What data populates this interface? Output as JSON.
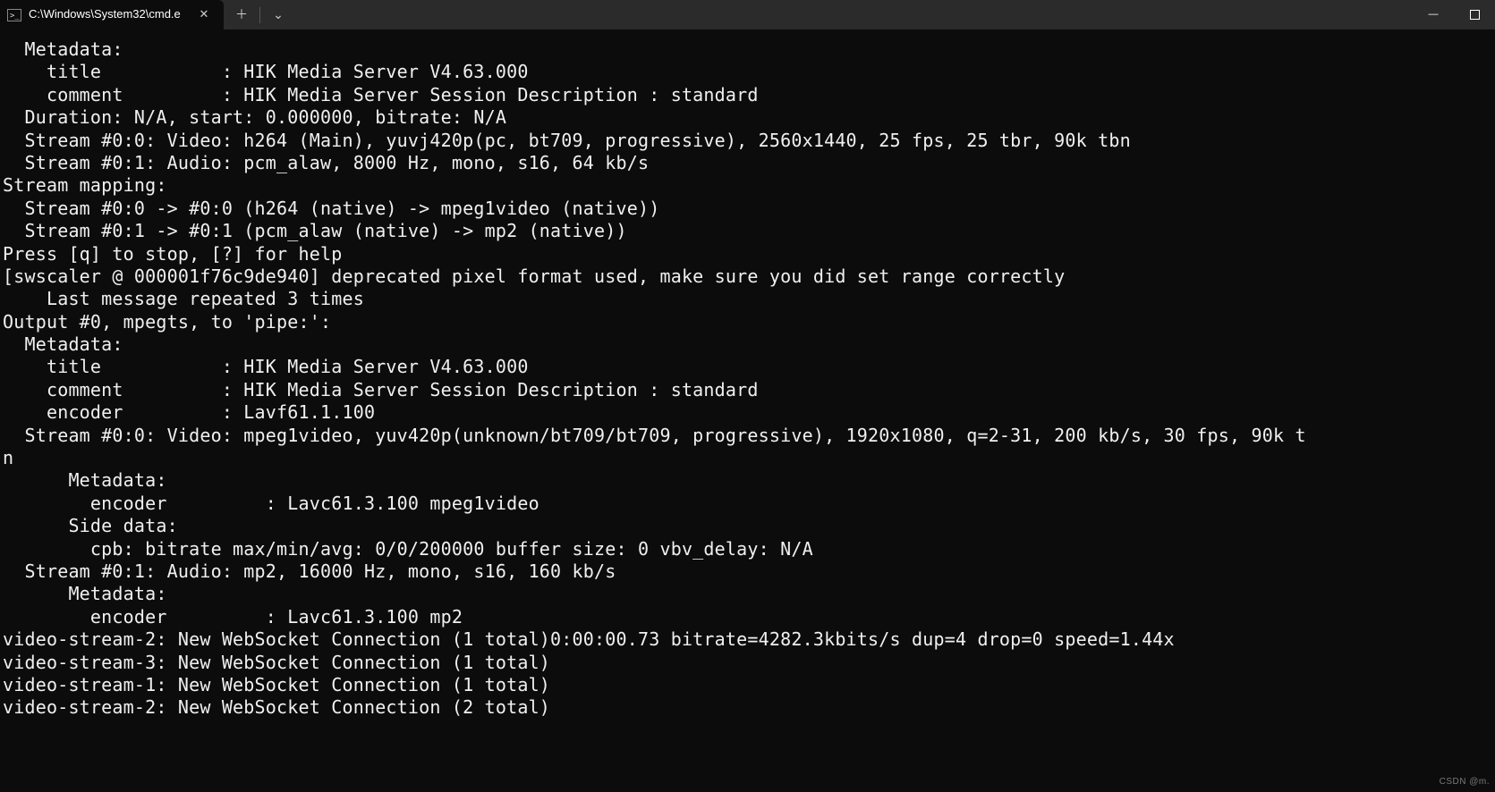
{
  "tab": {
    "title": "C:\\Windows\\System32\\cmd.e",
    "icon_glyph": "⧉"
  },
  "actions": {
    "close_tab": "✕",
    "new_tab": "＋",
    "dropdown": "⌄",
    "minimize": "—",
    "maximize": "▢",
    "close_window": "✕"
  },
  "terminal_lines": [
    "  Metadata:",
    "    title           : HIK Media Server V4.63.000",
    "    comment         : HIK Media Server Session Description : standard",
    "  Duration: N/A, start: 0.000000, bitrate: N/A",
    "  Stream #0:0: Video: h264 (Main), yuvj420p(pc, bt709, progressive), 2560x1440, 25 fps, 25 tbr, 90k tbn",
    "  Stream #0:1: Audio: pcm_alaw, 8000 Hz, mono, s16, 64 kb/s",
    "Stream mapping:",
    "  Stream #0:0 -> #0:0 (h264 (native) -> mpeg1video (native))",
    "  Stream #0:1 -> #0:1 (pcm_alaw (native) -> mp2 (native))",
    "Press [q] to stop, [?] for help",
    "[swscaler @ 000001f76c9de940] deprecated pixel format used, make sure you did set range correctly",
    "    Last message repeated 3 times",
    "Output #0, mpegts, to 'pipe:':",
    "  Metadata:",
    "    title           : HIK Media Server V4.63.000",
    "    comment         : HIK Media Server Session Description : standard",
    "    encoder         : Lavf61.1.100",
    "  Stream #0:0: Video: mpeg1video, yuv420p(unknown/bt709/bt709, progressive), 1920x1080, q=2-31, 200 kb/s, 30 fps, 90k t",
    "n",
    "      Metadata:",
    "        encoder         : Lavc61.3.100 mpeg1video",
    "      Side data:",
    "        cpb: bitrate max/min/avg: 0/0/200000 buffer size: 0 vbv_delay: N/A",
    "  Stream #0:1: Audio: mp2, 16000 Hz, mono, s16, 160 kb/s",
    "      Metadata:",
    "        encoder         : Lavc61.3.100 mp2",
    "video-stream-2: New WebSocket Connection (1 total)0:00:00.73 bitrate=4282.3kbits/s dup=4 drop=0 speed=1.44x",
    "video-stream-3: New WebSocket Connection (1 total)",
    "video-stream-1: New WebSocket Connection (1 total)",
    "video-stream-2: New WebSocket Connection (2 total)"
  ],
  "watermark": "CSDN @m."
}
